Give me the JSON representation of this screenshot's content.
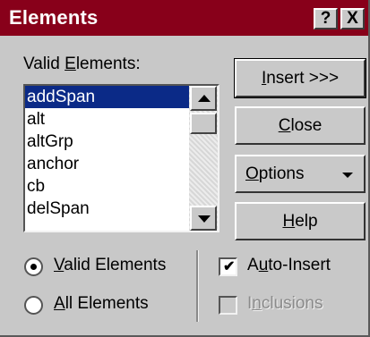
{
  "window": {
    "title": "Elements"
  },
  "titlebar": {
    "help_label": "?",
    "close_label": "X"
  },
  "list": {
    "label_prefix": "Valid ",
    "label_access": "E",
    "label_suffix": "lements:",
    "items": [
      "addSpan",
      "alt",
      "altGrp",
      "anchor",
      "cb",
      "delSpan"
    ],
    "selected": "addSpan"
  },
  "buttons": {
    "insert": {
      "access": "I",
      "rest": "nsert >>>"
    },
    "close": {
      "access": "C",
      "rest": "lose"
    },
    "options": {
      "access": "O",
      "rest": "ptions"
    },
    "help": {
      "access": "H",
      "rest": "elp"
    }
  },
  "filter": {
    "valid": {
      "access": "V",
      "rest": "alid Elements",
      "selected": true
    },
    "all": {
      "access": "A",
      "rest": "ll Elements",
      "selected": false
    }
  },
  "checks": {
    "auto_insert": {
      "prefix": "A",
      "access": "u",
      "rest": "to-Insert",
      "checked": true
    },
    "inclusions": {
      "prefix": "I",
      "access": "n",
      "rest": "clusions",
      "checked": false,
      "disabled": true
    }
  },
  "colors": {
    "titlebar": "#88001a",
    "selection": "#0b2a87",
    "face": "#c8c8c8"
  },
  "icons": {
    "checkmark": "checkmark-icon",
    "scroll_up": "scroll-up-icon",
    "scroll_down": "scroll-down-icon",
    "dropdown": "dropdown-arrow-icon"
  }
}
